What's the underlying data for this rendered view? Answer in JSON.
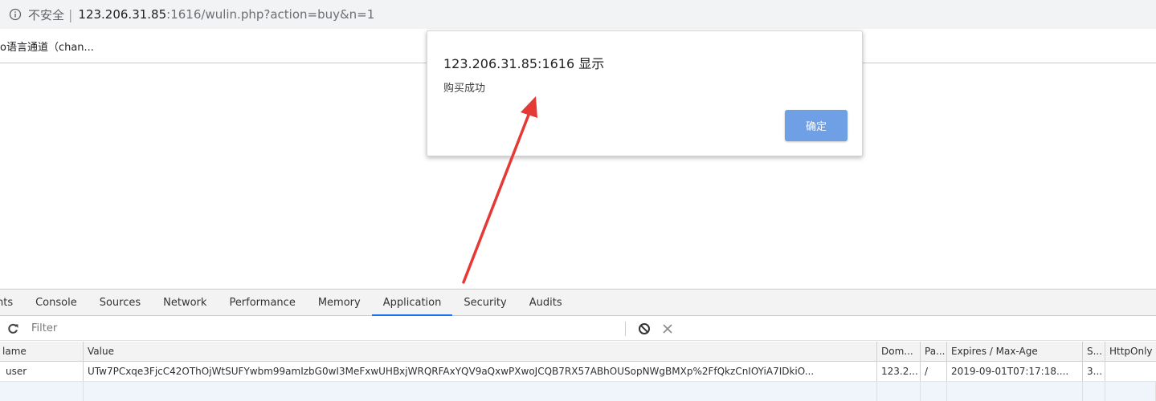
{
  "address_bar": {
    "security_text": "不安全",
    "separator": "|",
    "url_host": "123.206.31.85",
    "url_rest": ":1616/wulin.php?action=buy&n=1"
  },
  "bookmarks": {
    "items": [
      {
        "label": "o语言通道（chan..."
      }
    ]
  },
  "dialog": {
    "title": "123.206.31.85:1616 显示",
    "message": "购买成功",
    "ok_label": "确定",
    "ok_color": "#6fa0e6"
  },
  "annotation": {
    "arrow_color": "#e53935"
  },
  "devtools": {
    "tabs": [
      {
        "label": "nts"
      },
      {
        "label": "Console"
      },
      {
        "label": "Sources"
      },
      {
        "label": "Network"
      },
      {
        "label": "Performance"
      },
      {
        "label": "Memory"
      },
      {
        "label": "Application",
        "active": true
      },
      {
        "label": "Security"
      },
      {
        "label": "Audits"
      }
    ],
    "filter_placeholder": "Filter",
    "cookies": {
      "columns": [
        "lame",
        "Value",
        "Dom...",
        "Pa...",
        "Expires / Max-Age",
        "S...",
        "HttpOnly"
      ],
      "rows": [
        [
          "user",
          "UTw7PCxqe3FjcC42OThOjWtSUFYwbm99amIzbG0wI3MeFxwUHBxjWRQRFAxYQV9aQxwPXwoJCQB7RX57ABhOUSopNWgBMXp%2FfQkzCnIOYiA7IDkiO...",
          "123.2...",
          "/",
          "2019-09-01T07:17:18....",
          "3...",
          ""
        ]
      ]
    }
  }
}
